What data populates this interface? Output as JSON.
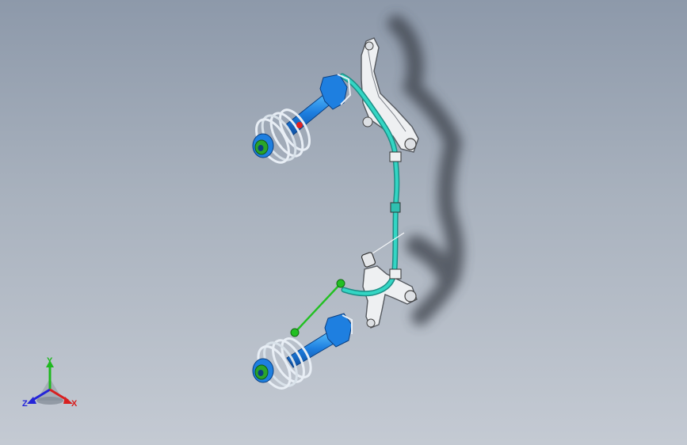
{
  "viewport": {
    "background_top": "#8d99aa",
    "background_bottom": "#c4cad3"
  },
  "model": {
    "description_icon": "front-suspension-assembly",
    "colors": {
      "strut": "#1e7fe0",
      "strut_highlight": "#5fc6ff",
      "spring": "#e8eef5",
      "mount": "#2aa52a",
      "stabilizer_bar": "#33d6c4",
      "control_arm": "#eef0f2",
      "link": "#22c022",
      "shadow": "#3a3f48"
    }
  },
  "triad": {
    "axis_y": "Y",
    "axis_z": "Z",
    "axis_x": "X",
    "color_y": "#1fb81f",
    "color_z": "#2424d8",
    "color_x": "#d82020"
  }
}
